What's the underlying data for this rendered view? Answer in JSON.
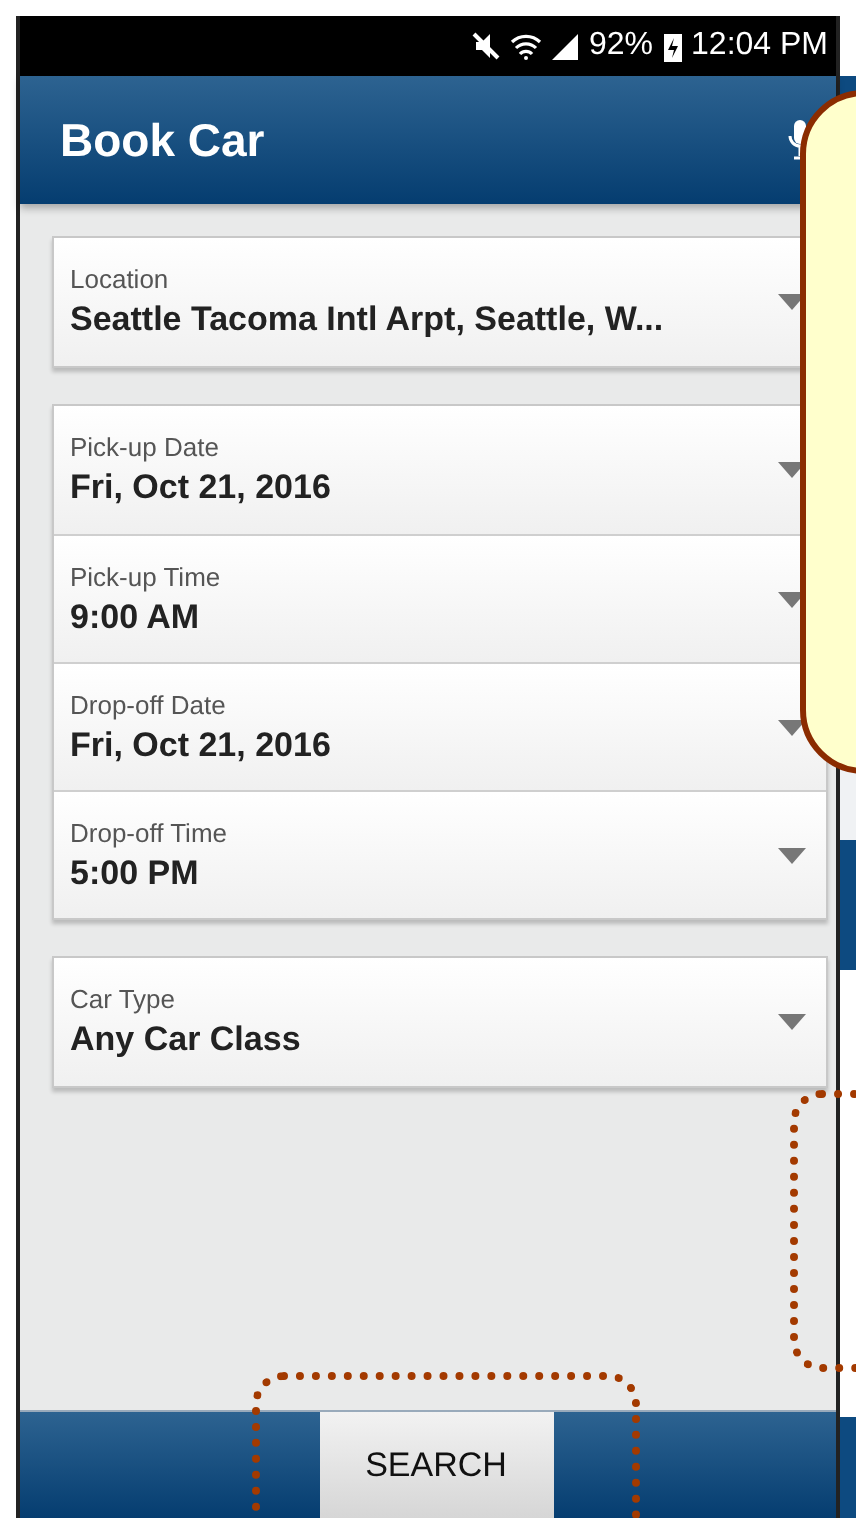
{
  "status_bar": {
    "battery": "92%",
    "time": "12:04 PM"
  },
  "app_bar": {
    "title": "Book Car"
  },
  "field_groups": [
    [
      {
        "label": "Location",
        "value": "Seattle Tacoma Intl Arpt, Seattle, W..."
      }
    ],
    [
      {
        "label": "Pick-up Date",
        "value": "Fri, Oct 21, 2016"
      },
      {
        "label": "Pick-up Time",
        "value": "9:00 AM"
      },
      {
        "label": "Drop-off Date",
        "value": "Fri, Oct 21, 2016"
      },
      {
        "label": "Drop-off Time",
        "value": "5:00 PM"
      }
    ],
    [
      {
        "label": "Car Type",
        "value": "Any Car Class"
      }
    ]
  ],
  "search_button": "SEARCH"
}
